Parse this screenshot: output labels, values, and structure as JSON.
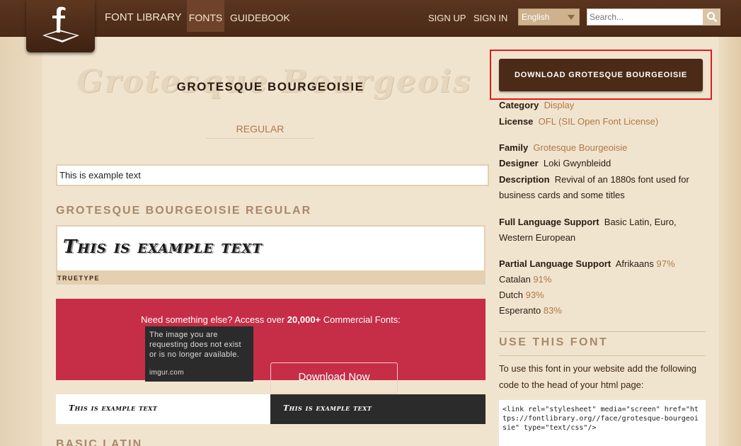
{
  "nav": {
    "brand": "FONT LIBRARY",
    "fonts": "FONTS",
    "guidebook": "GUIDEBOOK",
    "sign_up": "SIGN UP",
    "sign_in": "SIGN IN",
    "language": "English",
    "search_placeholder": "Search..."
  },
  "font": {
    "title": "GROTESQUE BOURGEOISIE",
    "title_background": "Grotesque Bourgeoisie",
    "style_tab": "REGULAR",
    "example_input": "This is example text",
    "section_heading": "GROTESQUE BOURGEOISIE REGULAR",
    "preview_text": "This is example text",
    "format": "TRUETYPE"
  },
  "banner": {
    "text_pre": "Need something else? Access over ",
    "text_bold": "20,000+",
    "text_post": " Commercial Fonts:",
    "button": "Download Now",
    "imgur_message": "The image you are requesting does not exist or is no longer available.",
    "imgur_host": "imgur.com"
  },
  "samples": {
    "light": "This is example text",
    "dark": "This is example text"
  },
  "next_section": "BASIC LATIN",
  "sidebar": {
    "download_button": "DOWNLOAD GROTESQUE BOURGEOISIE",
    "category_label": "Category",
    "category_value": "Display",
    "license_label": "License",
    "license_value": "OFL (SIL Open Font License)",
    "family_label": "Family",
    "family_value": "Grotesque Bourgeoisie",
    "designer_label": "Designer",
    "designer_value": "Loki Gwynbleidd",
    "description_label": "Description",
    "description_value": "Revival of an 1880s font used for business cards and some titles",
    "full_support_label": "Full Language Support",
    "full_support_value": "Basic Latin, Euro, Western European",
    "partial_support_label": "Partial Language Support",
    "partial_languages": [
      {
        "name": "Afrikaans",
        "pct": "97%"
      },
      {
        "name": "Catalan",
        "pct": "91%"
      },
      {
        "name": "Dutch",
        "pct": "93%"
      },
      {
        "name": "Esperanto",
        "pct": "83%"
      }
    ],
    "use_heading": "USE THIS FONT",
    "use_text": "To use this font in your website add the following code to the head of your html page:",
    "code": "<link rel=\"stylesheet\" media=\"screen\" href=\"https://fontlibrary.org//face/grotesque-bourgeoisie\" type=\"text/css\"/>"
  },
  "colors": {
    "header_brown": "#4a2a17",
    "link_tan": "#b07848",
    "banner_red": "#c62d46",
    "highlight_red": "#e11b1b"
  }
}
